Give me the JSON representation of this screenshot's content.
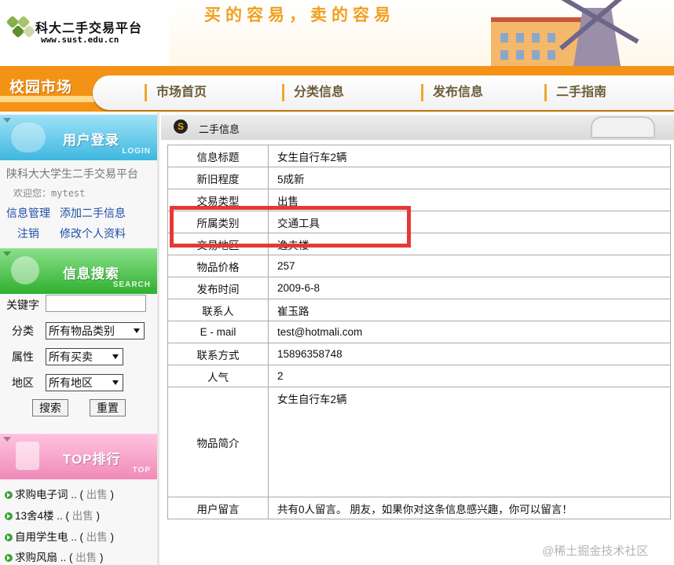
{
  "header": {
    "site_title": "科大二手交易平台",
    "site_url": "www.sust.edu.cn",
    "slogan": "买的容易，卖的容易"
  },
  "nav": {
    "brand": "校园市场",
    "items": [
      {
        "label": "市场首页"
      },
      {
        "label": "分类信息"
      },
      {
        "label": "发布信息"
      },
      {
        "label": "二手指南"
      }
    ]
  },
  "sidebar": {
    "login": {
      "title": "用户登录",
      "sub": "LOGIN",
      "site_name": "陕科大大学生二手交易平台",
      "welcome_prefix": "欢迎您：",
      "username": "mytest",
      "links": {
        "manage": "信息管理",
        "add": "添加二手信息",
        "logout": "注销",
        "profile": "修改个人资料"
      }
    },
    "search": {
      "title": "信息搜索",
      "sub": "SEARCH",
      "keyword_label": "关键字",
      "keyword_value": "",
      "category_label": "分类",
      "category_value": "所有物品类别",
      "attr_label": "属性",
      "attr_value": "所有买卖",
      "area_label": "地区",
      "area_value": "所有地区",
      "search_btn": "搜索",
      "reset_btn": "重置"
    },
    "top": {
      "title": "TOP排行",
      "sub": "TOP",
      "items": [
        {
          "name": "求购电子词 ..",
          "tag": "出售"
        },
        {
          "name": "13舍4楼 ..",
          "tag": "出售"
        },
        {
          "name": "自用学生电 ..",
          "tag": "出售"
        },
        {
          "name": "求购风扇 ..",
          "tag": "出售"
        }
      ]
    }
  },
  "main": {
    "section_title": "二手信息",
    "section_icon": "S",
    "rows": [
      {
        "key": "信息标题",
        "value": "女生自行车2辆"
      },
      {
        "key": "新旧程度",
        "value": "5成新"
      },
      {
        "key": "交易类型",
        "value": "出售"
      },
      {
        "key": "所属类别",
        "value": "交通工具"
      },
      {
        "key": "交易地区",
        "value": "逸夫楼"
      },
      {
        "key": "物品价格",
        "value": "257"
      },
      {
        "key": "发布时间",
        "value": "2009-6-8"
      },
      {
        "key": "联系人",
        "value": "崔玉路"
      },
      {
        "key": "E - mail",
        "value": "test@hotmali.com"
      },
      {
        "key": "联系方式",
        "value": "15896358748"
      },
      {
        "key": "人气",
        "value": "2"
      }
    ],
    "intro": {
      "key": "物品简介",
      "value": "女生自行车2辆"
    },
    "comment": {
      "key": "用户留言",
      "value": "共有0人留言。 朋友，如果你对这条信息感兴趣，你可以留言！"
    }
  },
  "watermark": "@稀土掘金技术社区",
  "colors": {
    "nav_orange": "#f39215",
    "highlight_red": "#e53935",
    "link_blue": "#1f4fa8"
  }
}
